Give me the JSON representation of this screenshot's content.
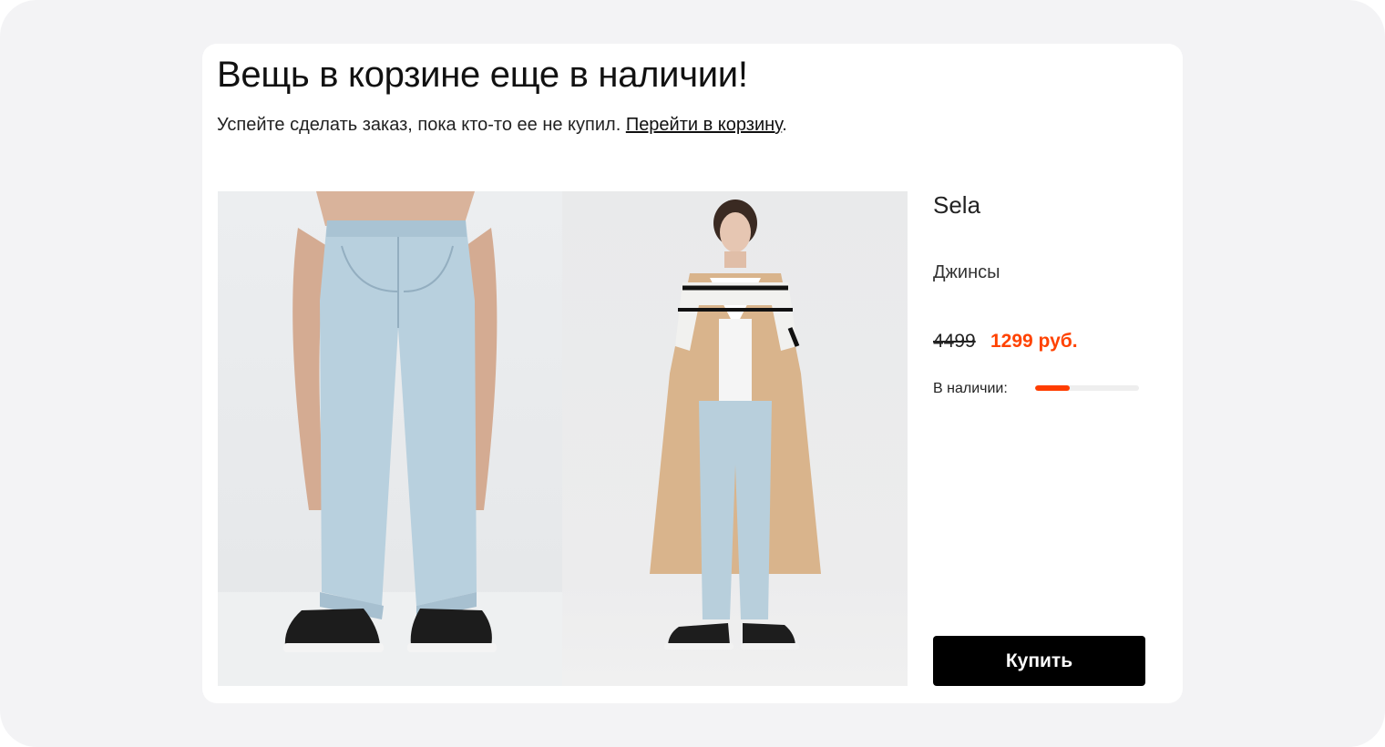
{
  "email": {
    "headline": "Вещь в корзине еще в наличии!",
    "subline_text": "Успейте сделать заказ, пока кто-то ее не купил. ",
    "cart_link": "Перейти в корзину",
    "subline_end": "."
  },
  "product": {
    "brand": "Sela",
    "type": "Джинсы",
    "old_price": "4499",
    "new_price": "1299 руб.",
    "stock_label": "В наличии:",
    "stock_level": 0.33,
    "buy_label": "Купить"
  },
  "colors": {
    "accent": "#ff4200",
    "button": "#000000"
  }
}
